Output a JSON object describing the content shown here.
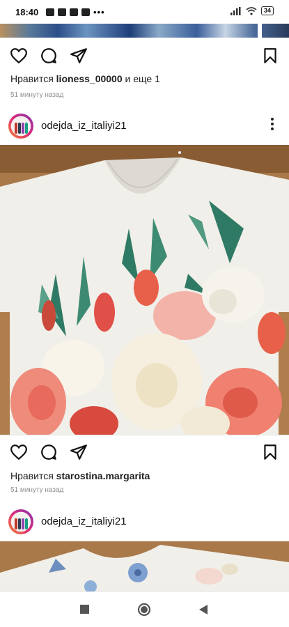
{
  "status_bar": {
    "time": "18:40",
    "battery": "34"
  },
  "posts": [
    {
      "likes_prefix": "Нравится",
      "likes_user": "lioness_00000",
      "likes_suffix": "и еще 1",
      "time_ago": "51 минуту назад"
    },
    {
      "username": "odejda_iz_italiyi21",
      "likes_prefix": "Нравится",
      "likes_user": "starostina.margarita",
      "time_ago": "51 минуту назад"
    },
    {
      "username": "odejda_iz_italiyi21"
    }
  ],
  "icons": [
    "heart-icon",
    "comment-icon",
    "share-icon",
    "bookmark-icon",
    "more-icon",
    "stop-icon",
    "home-icon",
    "back-icon",
    "wifi-icon",
    "signal-icon"
  ],
  "colors": {
    "text": "#111111",
    "meta": "#8e8e8e",
    "accent_red": "#e84a4a",
    "leaf_green": "#2f7a64"
  }
}
